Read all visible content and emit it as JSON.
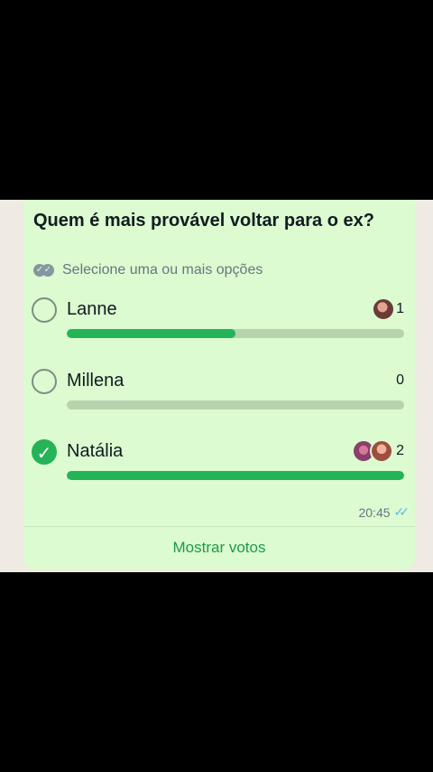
{
  "poll": {
    "question": "Quem é mais provável voltar para o ex?",
    "subtitle": "Selecione uma ou mais opções",
    "options": [
      {
        "label": "Lanne",
        "count": "1",
        "fraction": 0.5,
        "selected": false
      },
      {
        "label": "Millena",
        "count": "0",
        "fraction": 0.0,
        "selected": false
      },
      {
        "label": "Natália",
        "count": "2",
        "fraction": 1.0,
        "selected": true
      }
    ],
    "time": "20:45",
    "action_label": "Mostrar votos"
  },
  "colors": {
    "bubble": "#dcfbd0",
    "bar_fill": "#25b357",
    "bar_track": "#b7d3ad",
    "link": "#1e9a4e"
  }
}
